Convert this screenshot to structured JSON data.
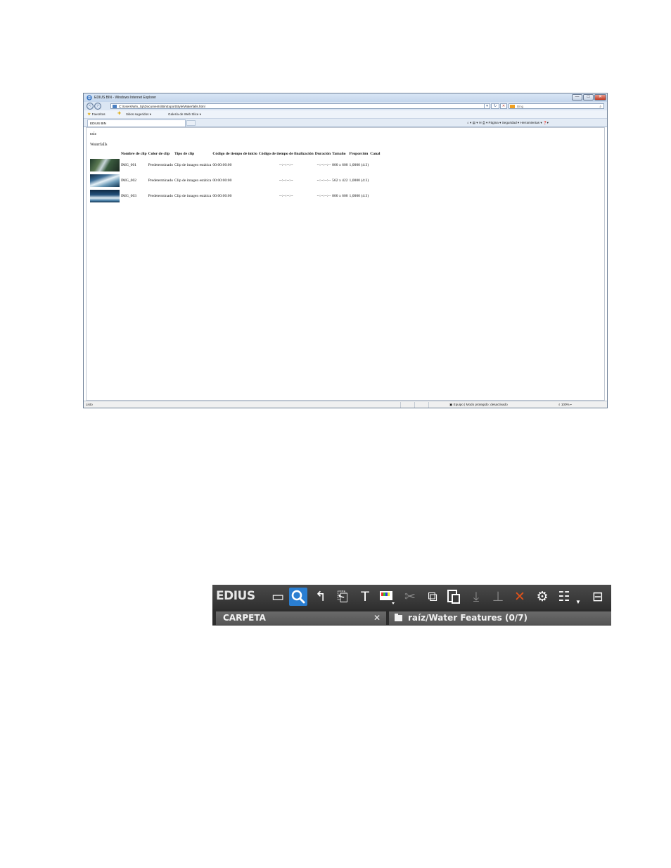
{
  "browser": {
    "title": "EDIUS BIN - Windows Internet Explorer",
    "window_buttons": {
      "minimize": "—",
      "maximize": "□",
      "close": "✕"
    },
    "address": "C:\\Users\\Win_Sp\\Documents\\BinExportStyle\\Waterfalls.html",
    "search_placeholder": "Bing",
    "favorites_label": "Favoritos",
    "favorites_items": [
      "Sitios sugeridos ▾",
      "Galería de Web Slice ▾"
    ],
    "tab_label": "EDIUS BIN",
    "command_bar": "Página ▾   Seguridad ▾   Herramientas ▾",
    "status_left": "Listo",
    "status_zone": "Equipo | Modo protegido: desactivado",
    "status_zoom": "100%"
  },
  "page": {
    "path": "raíz",
    "folder": "Waterfalls",
    "columns": [
      "",
      "Nombre de clip",
      "Color de clip",
      "Tipo de clip",
      "Código de tiempo de inicio",
      "Código de tiempo de finalización",
      "Duración",
      "Tamaño",
      "Proporción",
      "Canal"
    ],
    "rows": [
      {
        "name": "IMG_001",
        "color": "Predeterminado",
        "type": "Clip de imagen estática",
        "start": "00:00:00:00",
        "end": "--:--:--:--",
        "duration": "--:--:--:--",
        "size": "800 x 600",
        "ratio": "1,0000 (4:3)",
        "channel": ""
      },
      {
        "name": "IMG_002",
        "color": "Predeterminado",
        "type": "Clip de imagen estática",
        "start": "00:00:00:00",
        "end": "--:--:--:--",
        "duration": "--:--:--:--",
        "size": "562 x 422",
        "ratio": "1,0000 (4:3)",
        "channel": ""
      },
      {
        "name": "IMG_003",
        "color": "Predeterminado",
        "type": "Clip de imagen estática",
        "start": "00:00:00:00",
        "end": "--:--:--:--",
        "duration": "--:--:--:--",
        "size": "800 x 600",
        "ratio": "1,0000 (4:3)",
        "channel": ""
      }
    ]
  },
  "edius": {
    "logo": "EDIUS",
    "icons": {
      "new_folder": "▭",
      "search": "🔍",
      "up": "↰",
      "open": "⎗",
      "title": "T",
      "color_bars": "▦",
      "cut": "✂",
      "copy": "⧉",
      "paste": "📋",
      "add_timeline": "⤓",
      "insert": "⊥",
      "delete": "✕",
      "properties": "⚙",
      "view": "☷",
      "toolbox": "⊟"
    },
    "folder_header": "CARPETA",
    "folder_close": "✕",
    "bin_path": "raíz/Water Features (0/7)"
  }
}
